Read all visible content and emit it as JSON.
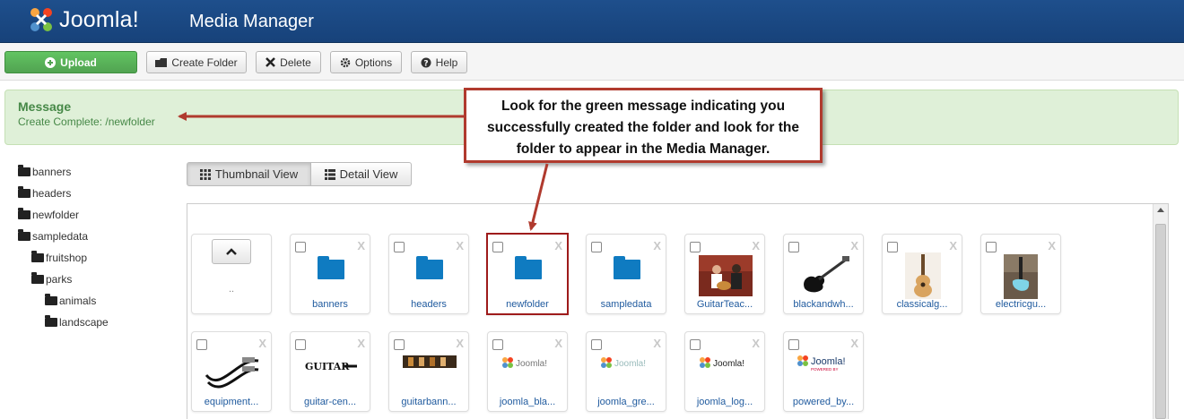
{
  "header": {
    "logo_text": "Joomla!",
    "title": "Media Manager"
  },
  "toolbar": {
    "upload": "Upload",
    "create_folder": "Create Folder",
    "delete": "Delete",
    "options": "Options",
    "help": "Help"
  },
  "message": {
    "heading": "Message",
    "text": "Create Complete: /newfolder"
  },
  "callout": {
    "text": "Look for the green message indicating you successfully created the folder and look for the folder to appear in the Media Manager."
  },
  "tree": [
    "banners",
    "headers",
    "newfolder",
    "sampledata",
    "fruitshop",
    "parks",
    "animals",
    "landscape"
  ],
  "views": {
    "thumbnail": "Thumbnail View",
    "detail": "Detail View"
  },
  "tiles": {
    "up_dots": "..",
    "delete_mark": "X",
    "row1": [
      "banners",
      "headers",
      "newfolder",
      "sampledata",
      "GuitarTeac...",
      "blackandwh...",
      "classicalg...",
      "electricgu..."
    ],
    "row2": [
      "equipment...",
      "guitar-cen...",
      "guitarbann...",
      "joomla_bla...",
      "joomla_gre...",
      "joomla_log...",
      "powered_by..."
    ]
  },
  "thumb_text": {
    "joomla": "Joomla!",
    "powered": "POWERED BY",
    "guitar_logo": "GUITAR"
  },
  "colors": {
    "header_bg": "#1b4885",
    "upload_green": "#51a351",
    "message_bg": "#dff0d8",
    "message_text": "#468847",
    "folder_blue": "#0f7bc1",
    "callout_red": "#b03a2e"
  }
}
